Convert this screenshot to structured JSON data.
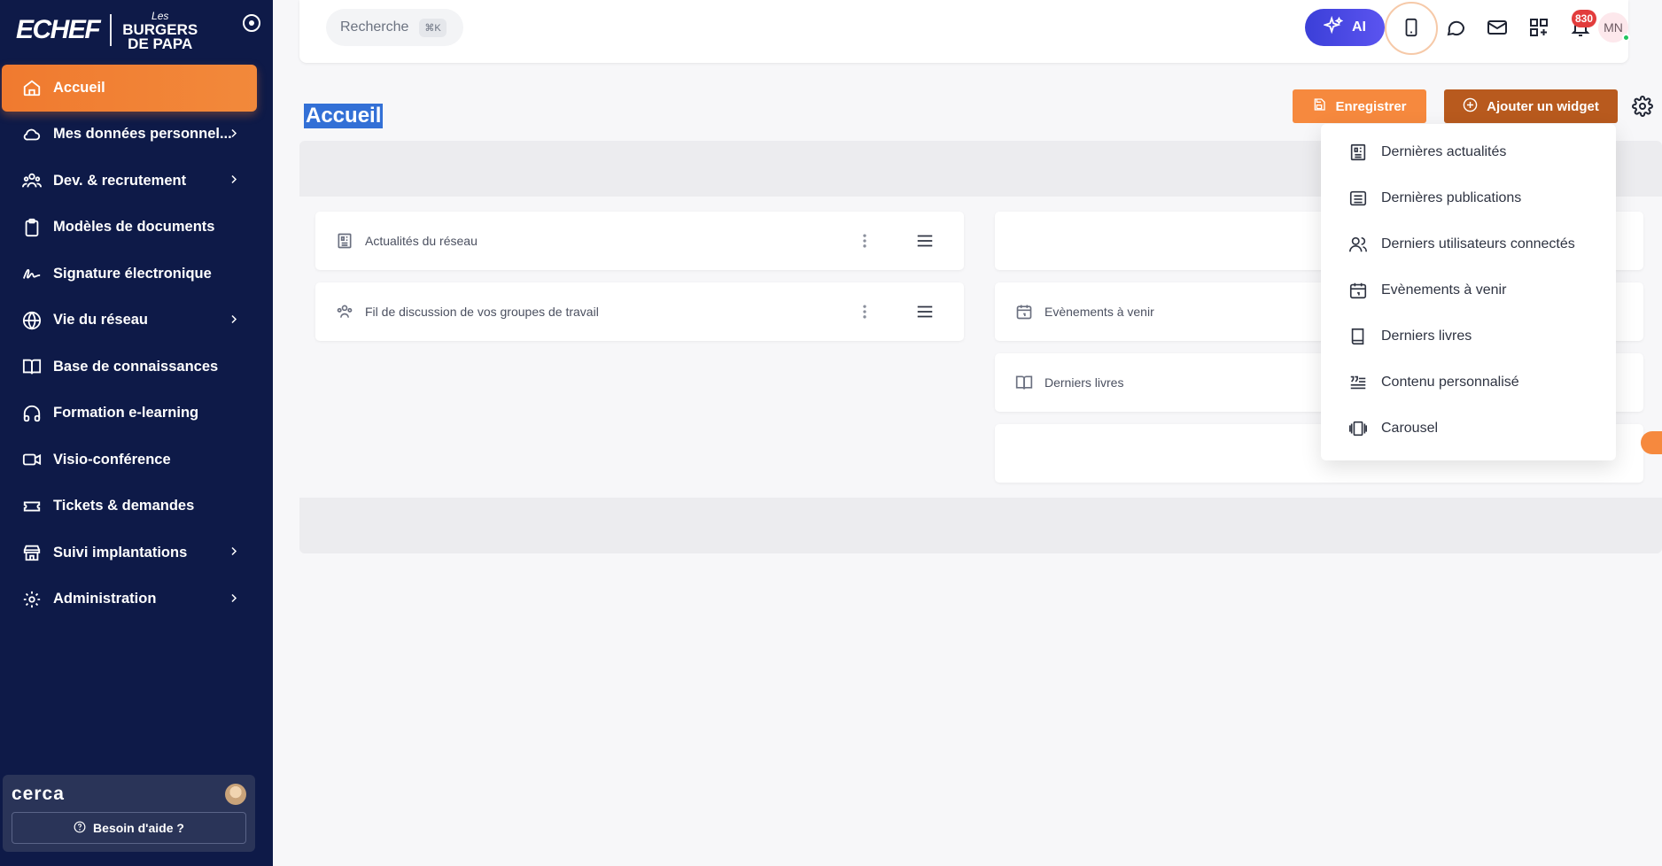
{
  "brand": {
    "logo": "ECHEF",
    "sub_top": "Les",
    "sub_main": "BURGERS",
    "sub_bottom": "de PAPA"
  },
  "sidebar": {
    "items": [
      {
        "label": "Accueil",
        "icon": "home-icon",
        "active": true,
        "chevron": false
      },
      {
        "label": "Mes données personnel...",
        "icon": "cloud-icon",
        "chevron": true
      },
      {
        "label": "Dev. & recrutement",
        "icon": "users-icon",
        "chevron": true
      },
      {
        "label": "Modèles de documents",
        "icon": "clipboard-icon",
        "chevron": false
      },
      {
        "label": "Signature électronique",
        "icon": "signature-icon",
        "chevron": false
      },
      {
        "label": "Vie du réseau",
        "icon": "globe-icon",
        "chevron": true
      },
      {
        "label": "Base de connaissances",
        "icon": "book-icon",
        "chevron": false
      },
      {
        "label": "Formation e-learning",
        "icon": "headphones-icon",
        "chevron": false
      },
      {
        "label": "Visio-conférence",
        "icon": "video-icon",
        "chevron": false
      },
      {
        "label": "Tickets & demandes",
        "icon": "ticket-icon",
        "chevron": false
      },
      {
        "label": "Suivi implantations",
        "icon": "store-icon",
        "chevron": true
      },
      {
        "label": "Administration",
        "icon": "gear-icon",
        "chevron": true
      }
    ],
    "help": {
      "brand": "cerca",
      "button": "Besoin d'aide ?"
    }
  },
  "topbar": {
    "search_placeholder": "Recherche",
    "search_shortcut": "⌘K",
    "ai_label": "AI",
    "notification_count": "830",
    "avatar_initials": "MN"
  },
  "page": {
    "title": "Accueil",
    "save_label": "Enregistrer",
    "add_widget_label": "Ajouter un widget"
  },
  "widgets": {
    "left": [
      {
        "label": "Actualités du réseau",
        "icon": "news-icon"
      },
      {
        "label": "Fil de discussion de vos groupes de travail",
        "icon": "users-icon"
      }
    ],
    "right": [
      {
        "label": "",
        "icon": ""
      },
      {
        "label": "Evènements à venir",
        "icon": "calendar-icon"
      },
      {
        "label": "Derniers livres",
        "icon": "book-icon"
      },
      {
        "label": "",
        "icon": ""
      }
    ]
  },
  "dropdown": {
    "items": [
      {
        "label": "Dernières actualités",
        "icon": "news-icon"
      },
      {
        "label": "Dernières publications",
        "icon": "list-icon"
      },
      {
        "label": "Derniers utilisateurs connectés",
        "icon": "users-icon"
      },
      {
        "label": "Evènements à venir",
        "icon": "calendar-icon"
      },
      {
        "label": "Derniers livres",
        "icon": "book-icon"
      },
      {
        "label": "Contenu personnalisé",
        "icon": "quote-icon"
      },
      {
        "label": "Carousel",
        "icon": "carousel-icon"
      }
    ]
  },
  "colors": {
    "sidebar_bg": "#0e1a48",
    "accent_orange": "#f07a2f",
    "add_widget_brown": "#b85a1e",
    "ai_gradient_start": "#3b3fd8",
    "badge_red": "#e23c3c",
    "title_highlight": "#3370d6"
  }
}
